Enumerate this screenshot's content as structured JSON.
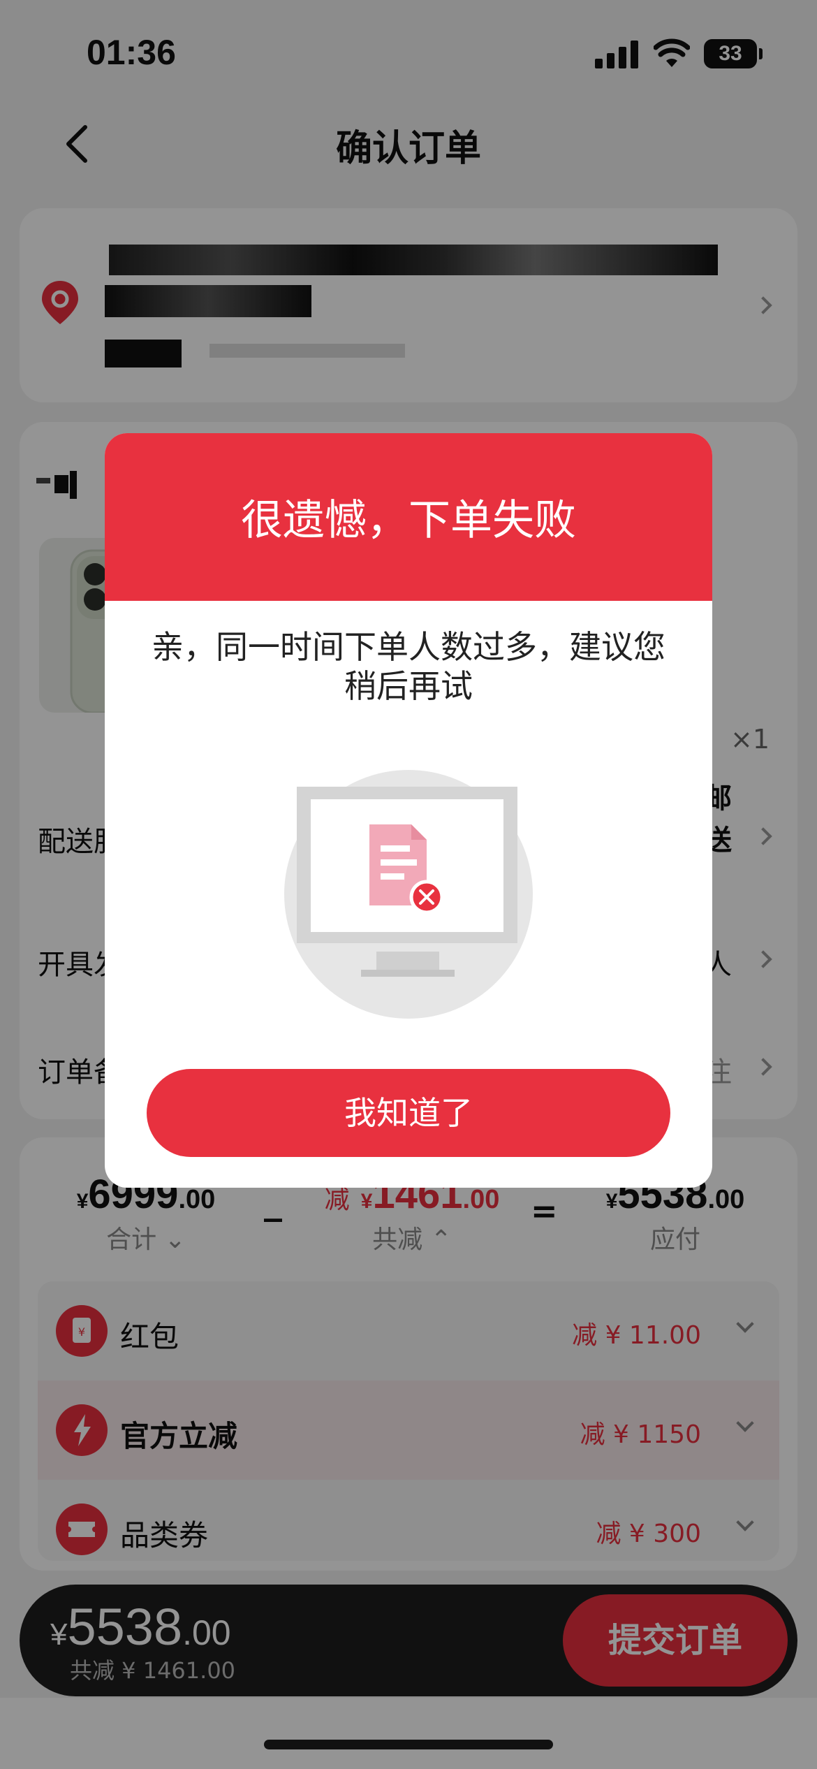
{
  "status_bar": {
    "time": "01:36",
    "battery": "33"
  },
  "nav": {
    "title": "确认订单"
  },
  "goods": {
    "quantity": "×1"
  },
  "rows": {
    "shipping_label": "配送服务",
    "shipping_value_1": "邮",
    "shipping_value_2": "送",
    "invoice_label": "开具发票",
    "invoice_value": "人",
    "remark_label": "订单备注",
    "remark_value": "注"
  },
  "prices": {
    "currency": "¥",
    "total_int": "6999",
    "total_dec": ".00",
    "total_label": "合计",
    "minus": "_",
    "discount_prefix": "减",
    "discount_int": "1461",
    "discount_dec": ".00",
    "discount_label": "共减",
    "equals": "=",
    "pay_int": "5538",
    "pay_dec": ".00",
    "pay_label": "应付"
  },
  "discounts": [
    {
      "label": "红包",
      "amount": "减 ¥ 11.00",
      "icon": "red-packet-icon"
    },
    {
      "label": "官方立减",
      "amount": "减 ¥ 1150",
      "icon": "lightning-icon"
    },
    {
      "label": "品类券",
      "amount": "减 ¥ 300",
      "icon": "ticket-icon"
    }
  ],
  "bottom_bar": {
    "currency": "¥",
    "total_int": "5538",
    "total_dec": ".00",
    "saved": "共减 ¥ 1461.00",
    "submit": "提交订单"
  },
  "modal": {
    "title": "很遗憾，下单失败",
    "message": "亲，同一时间下单人数过多，建议您稍后再试",
    "button": "我知道了",
    "illustration_icon": "order-failed-monitor-icon"
  },
  "colors": {
    "accent": "#e8313f",
    "dark_bar": "#1e1e1e"
  }
}
